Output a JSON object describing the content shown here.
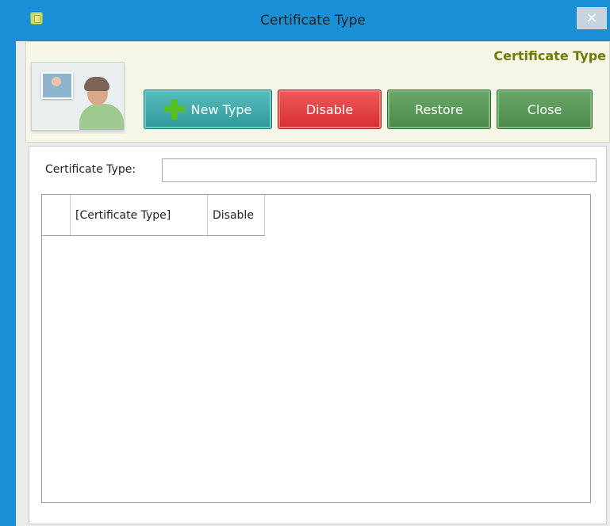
{
  "window": {
    "title": "Certificate Type",
    "close_label": "×"
  },
  "header": {
    "title": "Certificate Type",
    "buttons": {
      "new_type": "New Type",
      "disable": "Disable",
      "restore": "Restore",
      "close": "Close"
    },
    "colors": {
      "accent": "#6e7a00",
      "new": "#2f9898",
      "disable": "#d62f2f",
      "restore": "#4b8a4b"
    }
  },
  "form": {
    "label": "Certificate Type:",
    "value": ""
  },
  "grid": {
    "columns": [
      "",
      "[Certificate Type]",
      "Disable"
    ],
    "rows": []
  }
}
